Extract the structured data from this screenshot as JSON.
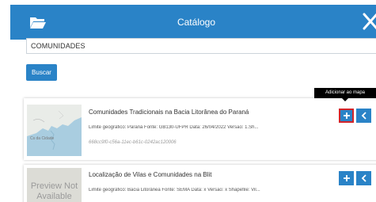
{
  "header": {
    "title": "Catálogo",
    "color": "#2a83c7"
  },
  "search": {
    "value": "COMUNIDADES",
    "button_label": "Buscar"
  },
  "tooltip": {
    "text": "Adicionar ao mapa"
  },
  "results": [
    {
      "title": "Comunidades Tradicionais na Bacia Litorânea do Paraná",
      "description": "Limite geográfico: Paraná Fonte: GB130-UFPR Data: 26/04/2022 Versão: 1.Sh...",
      "id": "668cc9f0-c56a-11ec-b61c-0242ac120006",
      "thumbnail": "map",
      "map_label": "Cs da Cidade"
    },
    {
      "title": "Localização de Vilas e Comunidades na Blit",
      "description": "Limite geográfico: Bacia Litorânea Fonte: SEMA Data: x Versão: x Shapefile: Vil...",
      "thumbnail": "preview",
      "preview_text": "Preview Not Available"
    }
  ],
  "icons": {
    "folder": "folder-open-icon",
    "close": "close-icon",
    "add": "plus-icon",
    "back": "chevron-left-icon"
  },
  "colors": {
    "accent": "#2a83c7",
    "highlight_border": "#d2242a"
  }
}
